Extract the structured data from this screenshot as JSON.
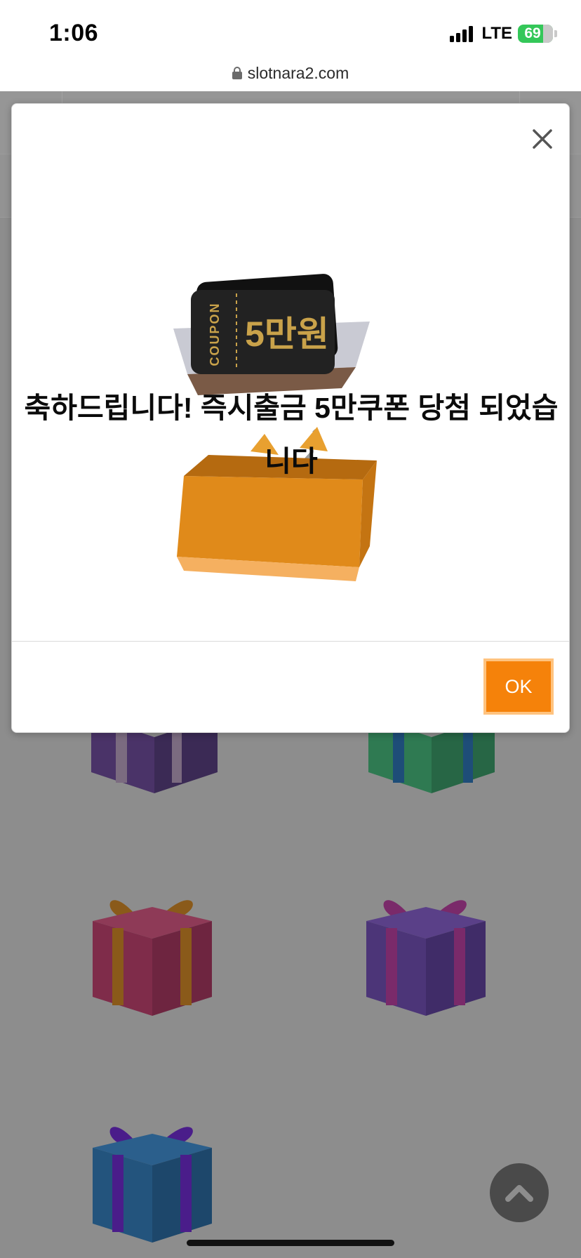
{
  "status_bar": {
    "time": "1:06",
    "network": "LTE",
    "battery": "69",
    "battery_color": "#34c759"
  },
  "browser": {
    "url": "slotnara2.com",
    "lock_icon": "lock-icon"
  },
  "modal": {
    "message": "축하드립니다! 즉시출금 5만쿠폰 당첨 되었습니다",
    "close_icon": "close-icon",
    "ok_label": "OK",
    "ok_color": "#f5820a",
    "coupon": {
      "label": "COUPON",
      "amount": "5만원"
    }
  },
  "background_page": {
    "gifts": [
      "purple-gift",
      "green-gift",
      "red-gift",
      "purple-gift",
      "blue-gift"
    ],
    "scroll_top_icon": "chevron-up-icon"
  }
}
